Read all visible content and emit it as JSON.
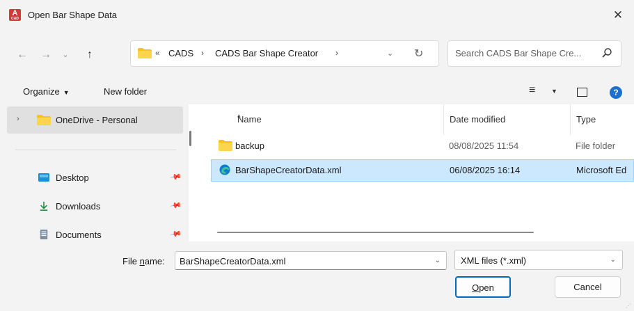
{
  "window": {
    "title": "Open Bar Shape Data",
    "app_icon_text": "A",
    "app_icon_sub": "CAD",
    "close_glyph": "✕"
  },
  "navigation": {
    "back_glyph": "←",
    "forward_glyph": "→",
    "recent_glyph": "⌄",
    "up_glyph": "↑"
  },
  "address_bar": {
    "overflow_glyph": "«",
    "crumbs": [
      "CADS",
      "CADS Bar Shape Creator"
    ],
    "separator": "›",
    "dropdown_glyph": "⌄",
    "refresh_glyph": "↻"
  },
  "search": {
    "placeholder": "Search CADS Bar Shape Cre..."
  },
  "command_bar": {
    "organize_label": "Organize",
    "organize_caret": "▼",
    "new_folder_label": "New folder",
    "view_glyph": "≡",
    "view_caret": "▼",
    "help_glyph": "?"
  },
  "nav_pane": {
    "onedrive": {
      "chevron": "›",
      "label": "OneDrive - Personal"
    },
    "quick_access": [
      {
        "label": "Desktop",
        "icon": "desktop-icon",
        "pin": "📌"
      },
      {
        "label": "Downloads",
        "icon": "download-icon",
        "pin": "📌"
      },
      {
        "label": "Documents",
        "icon": "documents-icon",
        "pin": "📌"
      }
    ]
  },
  "file_list": {
    "columns": {
      "name": "Name",
      "date": "Date modified",
      "type": "Type"
    },
    "sort_caret": "^",
    "rows": [
      {
        "name": "backup",
        "date": "08/08/2025 11:54",
        "type": "File folder",
        "icon": "folder-icon",
        "selected": false
      },
      {
        "name": "BarShapeCreatorData.xml",
        "date": "06/08/2025 16:14",
        "type": "Microsoft Ed",
        "icon": "edge-icon",
        "selected": true
      }
    ]
  },
  "bottom": {
    "file_name_label_prefix": "File ",
    "file_name_label_underlined": "n",
    "file_name_label_suffix": "ame:",
    "file_name_value": "BarShapeCreatorData.xml",
    "dropdown_glyph": "⌄",
    "filter_value": "XML files (*.xml)",
    "open_underlined": "O",
    "open_rest": "pen",
    "cancel_label": "Cancel"
  },
  "colors": {
    "selection_bg": "#cce8ff",
    "selection_border": "#99d1ff",
    "accent": "#0067c0",
    "folder": "#f7c21d",
    "help": "#1b6fd1"
  }
}
